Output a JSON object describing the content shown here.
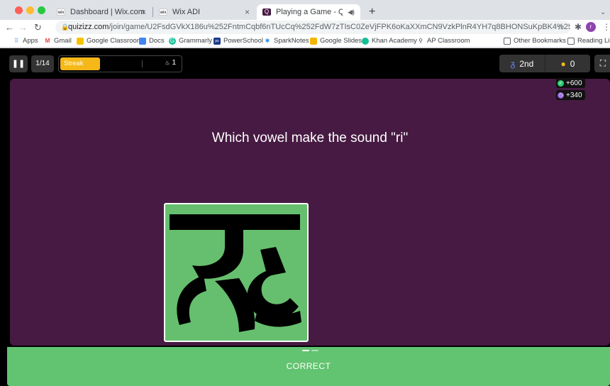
{
  "browser": {
    "tabs": [
      {
        "label": "Dashboard | Wix.com",
        "favicon": "wix-icon"
      },
      {
        "label": "Wix ADI",
        "favicon": "wix-icon"
      },
      {
        "label": "Playing a Game - Quizizz",
        "favicon": "quizizz-icon",
        "active": true
      }
    ],
    "new_tab": "+",
    "url_host": "quizizz.com",
    "url_path": "/join/game/U2FsdGVkX186u%252FntmCqbf6nTUcCq%252FdW7zTIsC0ZeVjFPK6oKaXXmCN9VzkPlnR4YH7q8BHONSuKpBK4%252FFO18Pg%253D%25...",
    "bookmarks": [
      "Apps",
      "Gmail",
      "Google Classroom",
      "Docs",
      "Grammarly",
      "PowerSchool",
      "SparkNotes",
      "Google Slides",
      "Khan Academy",
      "AP Classroom"
    ],
    "other_bookmarks": "Other Bookmarks",
    "reading_list": "Reading List"
  },
  "quiz": {
    "question_counter": "1/14",
    "streak_label": "Streak",
    "streak_count": "1",
    "streak_fraction": 0.33,
    "rank": "2nd",
    "score": "0",
    "bonus_correct": "+600",
    "bonus_time": "+340",
    "question": "Which vowel make the sound \"ri\"",
    "answer_glyph": "ऋ",
    "result": "CORRECT"
  },
  "colors": {
    "panel": "#461a42",
    "correct": "#62c370",
    "streak": "#f5b818"
  }
}
